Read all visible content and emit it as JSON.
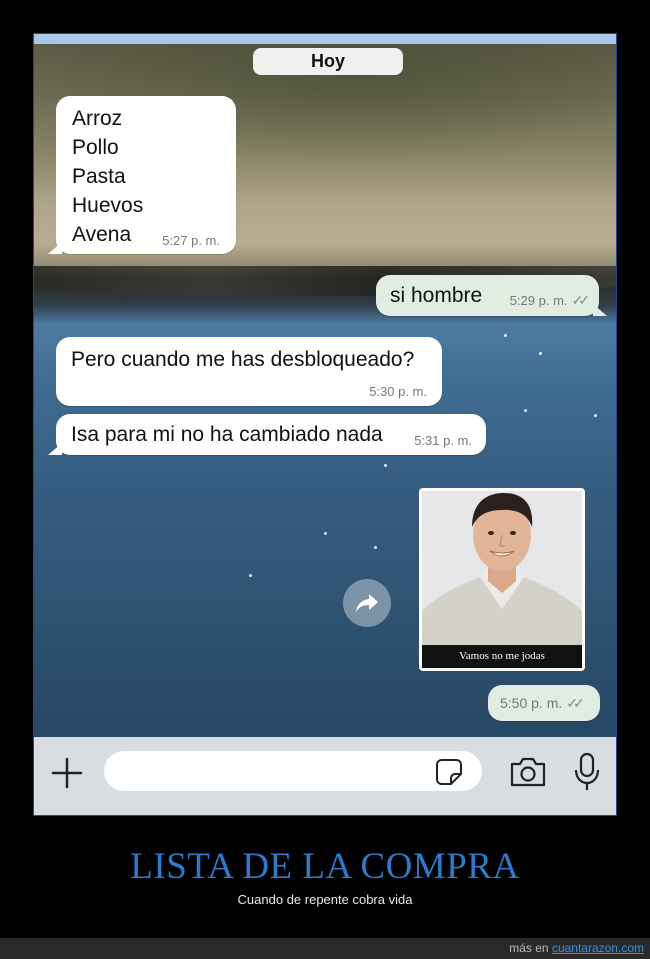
{
  "chat": {
    "date_label": "Hoy",
    "messages": [
      {
        "direction": "incoming",
        "lines": [
          "Arroz",
          "Pollo",
          "Pasta",
          "Huevos",
          "Avena"
        ],
        "time": "5:27 p. m."
      },
      {
        "direction": "outgoing",
        "text": "si hombre",
        "time": "5:29 p. m.",
        "ticks": "✓✓"
      },
      {
        "direction": "incoming",
        "text": "Pero cuando me has desbloqueado?",
        "time": "5:30 p. m."
      },
      {
        "direction": "incoming",
        "text": "Isa para mi no ha cambiado nada",
        "time": "5:31 p. m."
      },
      {
        "direction": "outgoing",
        "type": "image",
        "caption": "Vamos no me jodas"
      },
      {
        "direction": "outgoing",
        "time": "5:50 p. m.",
        "ticks": "✓✓"
      }
    ]
  },
  "input_bar": {
    "placeholder": "",
    "icons": [
      "plus-icon",
      "sticker-icon",
      "camera-icon",
      "microphone-icon"
    ]
  },
  "meme": {
    "title": "LISTA DE LA COMPRA",
    "subtitle": "Cuando de repente cobra vida",
    "footer_prefix": "más en",
    "footer_link": "cuantarazon.com"
  },
  "colors": {
    "incoming_bubble": "#ffffff",
    "outgoing_bubble": "#dfeee0",
    "title_blue": "#2c7ac9",
    "link_blue": "#3b8ee0"
  }
}
